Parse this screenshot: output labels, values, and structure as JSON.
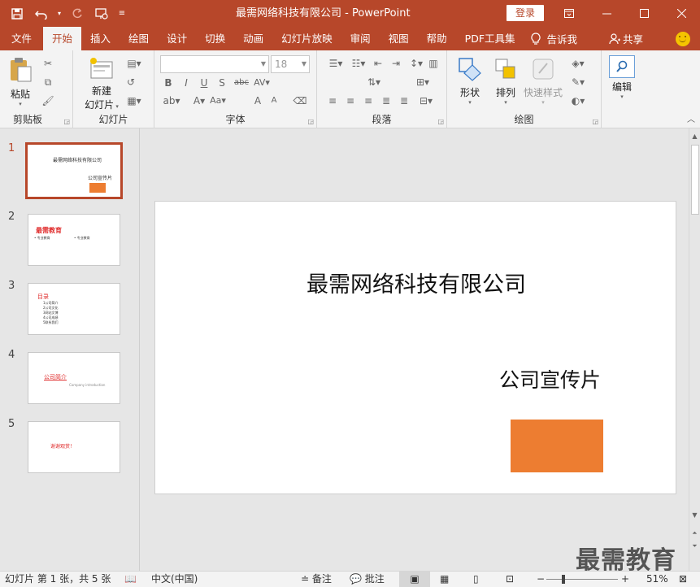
{
  "window": {
    "title": "最需网络科技有限公司  -  PowerPoint",
    "login_label": "登录"
  },
  "tabs": [
    {
      "label": "文件"
    },
    {
      "label": "开始"
    },
    {
      "label": "插入"
    },
    {
      "label": "绘图"
    },
    {
      "label": "设计"
    },
    {
      "label": "切换"
    },
    {
      "label": "动画"
    },
    {
      "label": "幻灯片放映"
    },
    {
      "label": "审阅"
    },
    {
      "label": "视图"
    },
    {
      "label": "帮助"
    },
    {
      "label": "PDF工具集"
    }
  ],
  "tell_me": "告诉我",
  "share": "共享",
  "ribbon": {
    "clipboard": {
      "label": "剪贴板",
      "paste": "粘贴"
    },
    "slides": {
      "label": "幻灯片",
      "new_slide_line1": "新建",
      "new_slide_line2": "幻灯片"
    },
    "font": {
      "label": "字体",
      "font_size": "18"
    },
    "paragraph": {
      "label": "段落"
    },
    "drawing": {
      "label": "绘图",
      "shapes": "形状",
      "arrange": "排列",
      "quick_styles": "快速样式"
    },
    "editing": {
      "label": "编辑"
    }
  },
  "thumbnails": [
    {
      "num": "1",
      "title": "最需网络科技有限公司",
      "sub": "公司宣传片"
    },
    {
      "num": "2",
      "title": "最需教育",
      "col1": "• 专业教育",
      "col2": "• 专业教育"
    },
    {
      "num": "3",
      "title": "目录",
      "items": [
        "1公司简介",
        "2公司文化",
        "3网站文博",
        "4公司成绩",
        "5联系我们"
      ]
    },
    {
      "num": "4",
      "title": "公司简介",
      "sub": "Company  introduction"
    },
    {
      "num": "5",
      "title": "谢谢观赏！"
    }
  ],
  "slide": {
    "title": "最需网络科技有限公司",
    "subtitle": "公司宣传片",
    "rect_color": "#ed7d31"
  },
  "status": {
    "slide_info": "幻灯片 第 1 张，共 5 张",
    "language": "中文(中国)",
    "notes": "备注",
    "comments": "批注",
    "zoom": "51%"
  },
  "watermark": "最需教育",
  "colors": {
    "accent": "#b7472a",
    "shape": "#ed7d31"
  }
}
